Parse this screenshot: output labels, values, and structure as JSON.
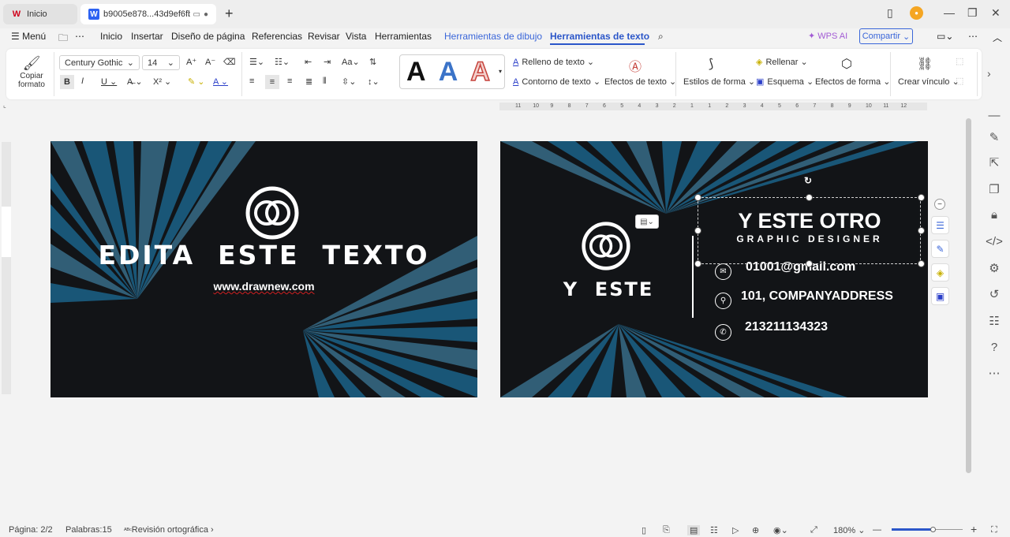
{
  "titlebar": {
    "home_tab": "Inicio",
    "doc_tab": "b9005e878...43d9ef6fb",
    "new_tab_icon": "plus-icon"
  },
  "menubar": {
    "menu_label": "Menú",
    "items": [
      "Inicio",
      "Insertar",
      "Diseño de página",
      "Referencias",
      "Revisar",
      "Vista",
      "Herramientas"
    ],
    "drawing_tools": "Herramientas de dibujo",
    "text_tools": "Herramientas de texto",
    "wps_ai": "WPS AI",
    "share": "Compartir"
  },
  "ribbon": {
    "copy_format": "Copiar formato",
    "font_name": "Century Gothic",
    "font_size": "14",
    "text_fill": "Relleno de texto",
    "text_outline": "Contorno de texto",
    "text_effects": "Efectos de texto",
    "shape_styles": "Estilos de forma",
    "fill": "Rellenar",
    "outline": "Esquema",
    "shape_effects": "Efectos de forma",
    "create_link": "Crear vínculo",
    "wordart": [
      "A",
      "A",
      "A"
    ]
  },
  "ruler": {
    "ticks": [
      "11",
      "10",
      "9",
      "8",
      "7",
      "6",
      "5",
      "4",
      "3",
      "2",
      "1",
      "1",
      "2",
      "3",
      "4",
      "5",
      "6",
      "7",
      "8",
      "9",
      "10",
      "11",
      "12"
    ]
  },
  "card_front": {
    "headline": "EDITA  ESTE  TEXTO",
    "website": "www.drawnew.com"
  },
  "card_back": {
    "brand": "Y  ESTE",
    "name": "Y ESTE OTRO",
    "role": "GRAPHIC DESIGNER",
    "email": "01001@gmail.com",
    "address": "101, COMPANYADDRESS",
    "phone": "213211134323"
  },
  "statusbar": {
    "page": "Página: 2/2",
    "words": "Palabras:15",
    "spellcheck": "Revisión ortográfica",
    "zoom": "180%"
  },
  "colors": {
    "card_bg": "#121417",
    "ray_blue": "#1b5d82",
    "ray_light": "#4b9bc4",
    "accent": "#2b56c9"
  }
}
